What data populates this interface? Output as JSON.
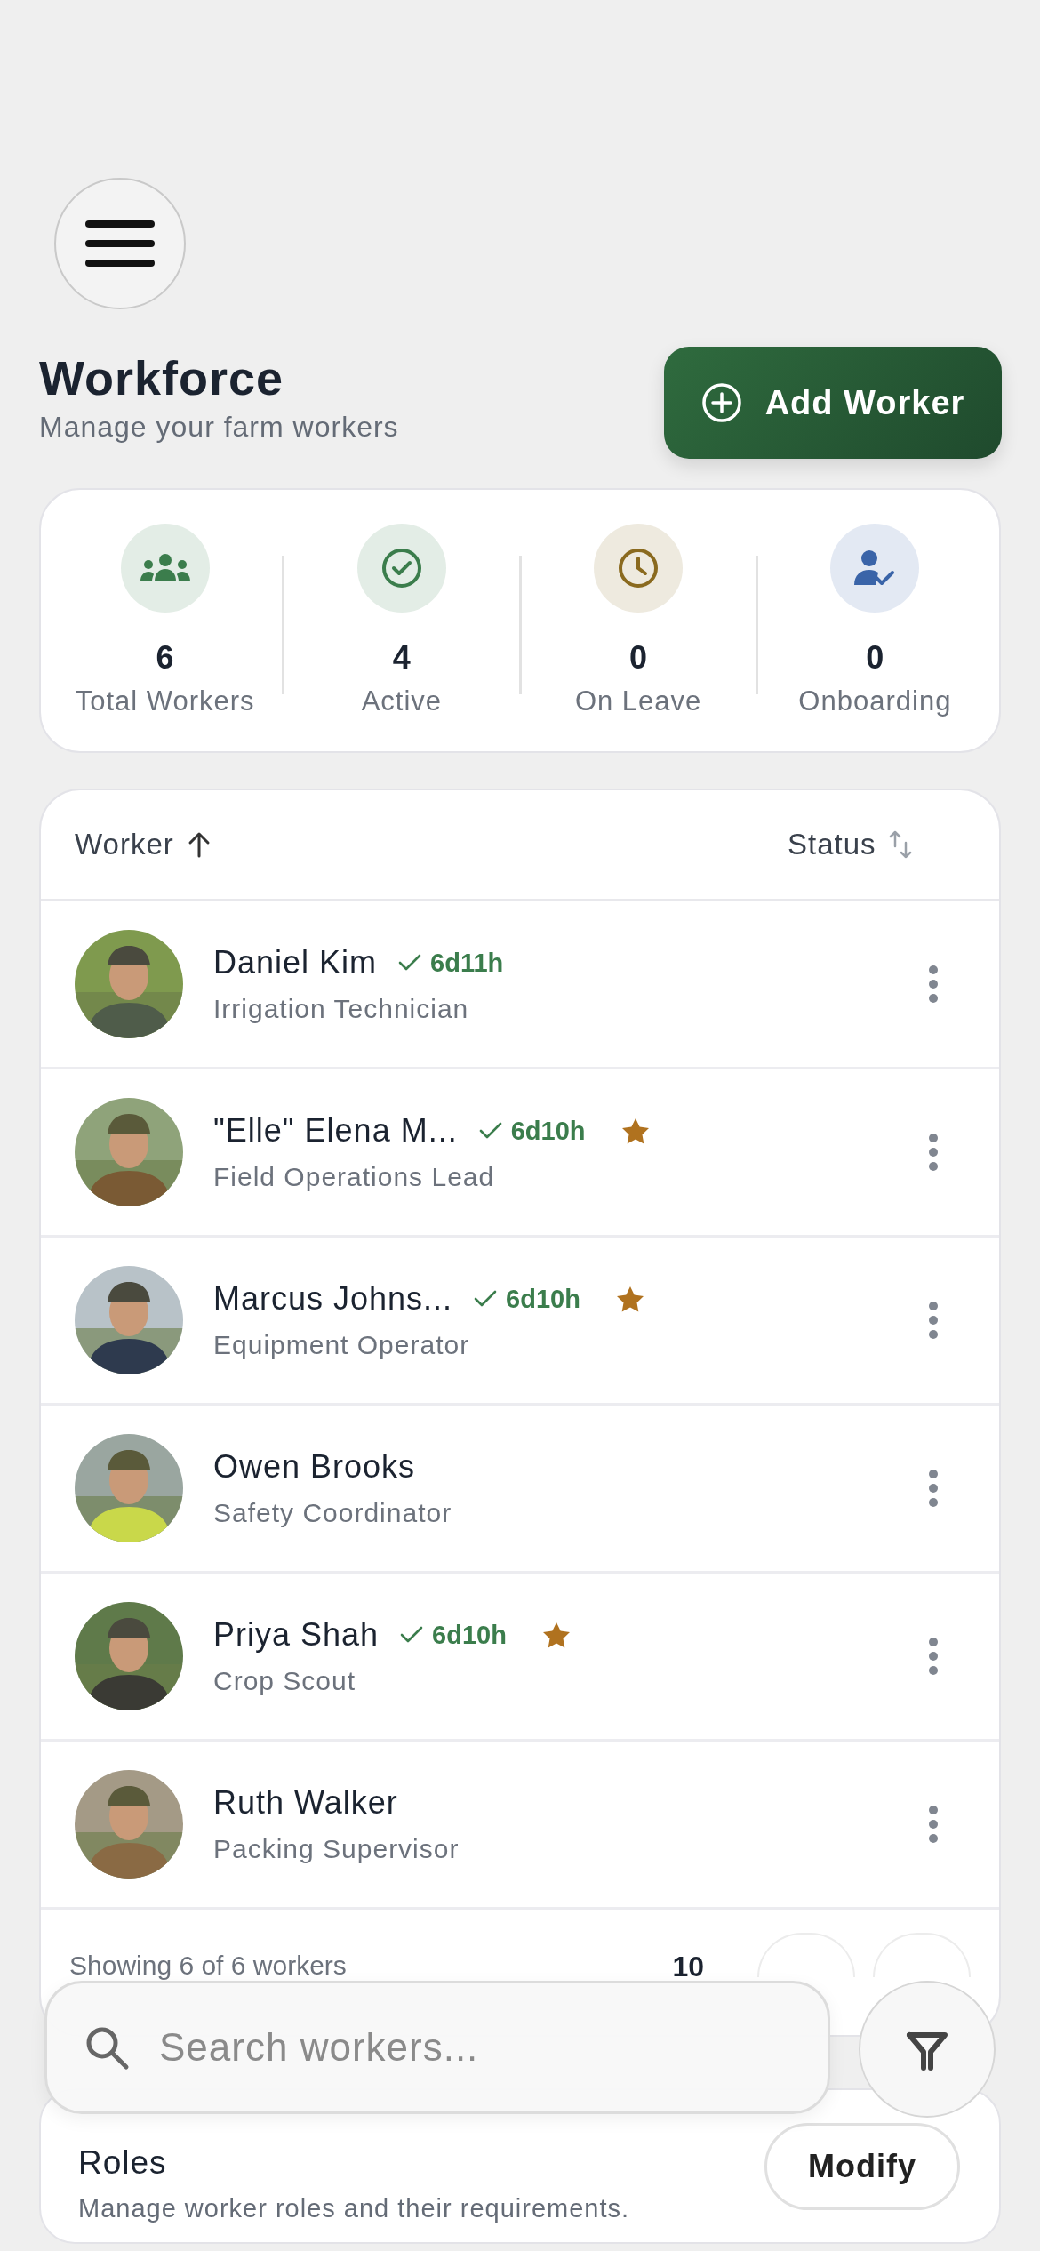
{
  "header": {
    "title": "Workforce",
    "subtitle": "Manage your farm workers",
    "add_button": "Add Worker"
  },
  "stats": [
    {
      "kind": "group",
      "value": "6",
      "label": "Total Workers",
      "color": "#3b7d4c"
    },
    {
      "kind": "check",
      "value": "4",
      "label": "Active",
      "color": "#3b7d4c"
    },
    {
      "kind": "clock",
      "value": "0",
      "label": "On Leave",
      "color": "#8a6a1f"
    },
    {
      "kind": "person",
      "value": "0",
      "label": "Onboarding",
      "color": "#3a64a8"
    }
  ],
  "table": {
    "columns": [
      {
        "label": "Worker",
        "kind": "sorted"
      },
      {
        "label": "Status",
        "kind": "sortable"
      }
    ],
    "rows": [
      {
        "name": "Daniel Kim",
        "role": "Irrigation Technician",
        "time": "6d11h",
        "starred": false
      },
      {
        "name": "\"Elle\" Elena M...",
        "role": "Field Operations Lead",
        "time": "6d10h",
        "starred": true
      },
      {
        "name": "Marcus Johns...",
        "role": "Equipment Operator",
        "time": "6d10h",
        "starred": true
      },
      {
        "name": "Owen Brooks",
        "role": "Safety Coordinator",
        "starred": false
      },
      {
        "name": "Priya Shah",
        "role": "Crop Scout",
        "time": "6d10h",
        "starred": true
      },
      {
        "name": "Ruth Walker",
        "role": "Packing Supervisor",
        "starred": false
      }
    ],
    "footer": {
      "summary": "Showing 6 of 6 workers",
      "page_size": "10"
    }
  },
  "search": {
    "placeholder": "Search workers..."
  },
  "roles": {
    "title": "Roles",
    "description": "Manage worker roles and their requirements.",
    "button": "Modify"
  }
}
